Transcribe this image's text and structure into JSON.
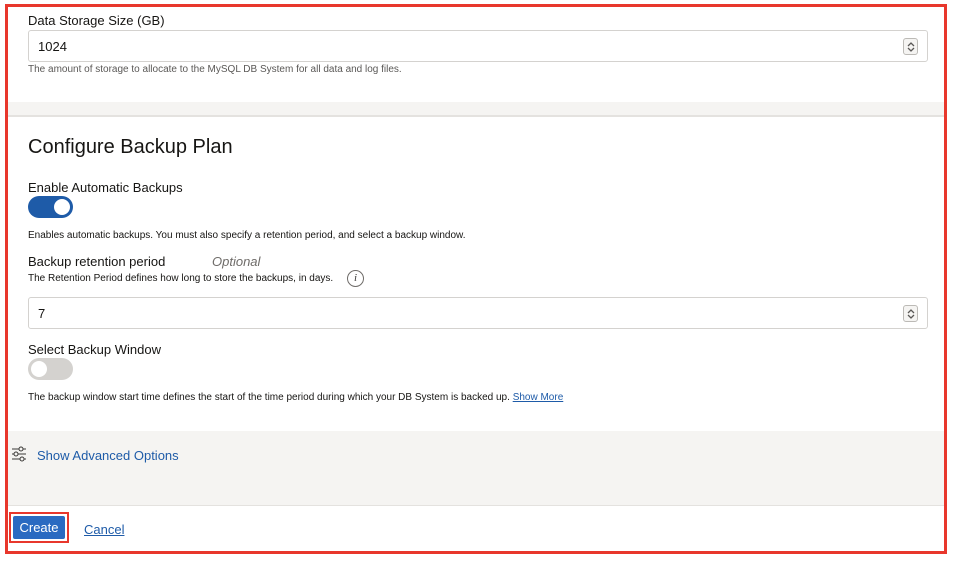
{
  "storage": {
    "label": "Data Storage Size (GB)",
    "value": "1024",
    "help": "The amount of storage to allocate to the MySQL DB System for all data and log files."
  },
  "backup": {
    "section_title": "Configure Backup Plan",
    "enable_label": "Enable Automatic Backups",
    "enable_on": true,
    "enable_help": "Enables automatic backups. You must also specify a retention period, and select a backup window.",
    "retention_label": "Backup retention period",
    "retention_optional": "Optional",
    "retention_help": "The Retention Period defines how long to store the backups, in days.",
    "info_glyph": "i",
    "retention_value": "7",
    "window_label": "Select Backup Window",
    "window_on": false,
    "window_help": "The backup window start time defines the start of the time period during which your DB System is backed up.",
    "show_more": "Show More"
  },
  "advanced": {
    "label": "Show Advanced Options",
    "icon": "sliders-icon"
  },
  "footer": {
    "create_label": "Create",
    "cancel_label": "Cancel"
  },
  "colors": {
    "accent": "#1e5ba8",
    "button": "#2a6ac1",
    "highlight_border": "#e8372c",
    "toggle_off": "#d4d2cf"
  }
}
